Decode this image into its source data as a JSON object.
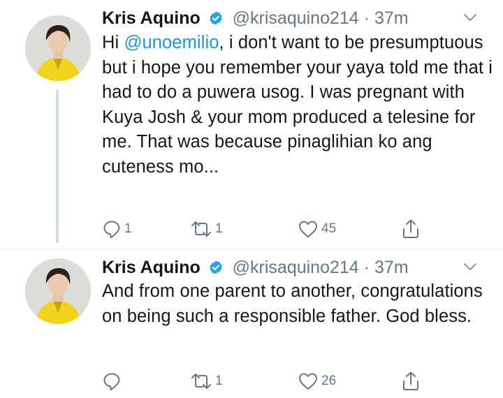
{
  "tweets": [
    {
      "name": "Kris Aquino",
      "handle": "@krisaquino214",
      "dot": "·",
      "time": "37m",
      "text_prefix": "Hi ",
      "mention": "@unoemilio",
      "text_body": ", i don't want to be presumptuous but i hope you remember your yaya told me that i had to do a puwera usog. I was pregnant with Kuya Josh & your mom produced a telesine for me. That was because pinaglihian ko ang cuteness mo...",
      "replies": "1",
      "retweets": "1",
      "likes": "45"
    },
    {
      "name": "Kris Aquino",
      "handle": "@krisaquino214",
      "dot": "·",
      "time": "37m",
      "text": "And from one parent to another, congratulations on being such a responsible father. God bless.",
      "replies": "",
      "retweets": "1",
      "likes": "26"
    }
  ],
  "icons": {
    "avatar": "profile-photo-woman-yellow-blazer",
    "verified": "verified-badge-icon",
    "chevron": "chevron-down-icon",
    "reply": "reply-icon",
    "retweet": "retweet-icon",
    "like": "heart-icon",
    "share": "share-icon"
  },
  "colors": {
    "text": "#14171a",
    "secondary": "#657786",
    "link": "#1b95e0",
    "verified": "#1da1f2",
    "avatar_blazer": "#f2d21b"
  }
}
